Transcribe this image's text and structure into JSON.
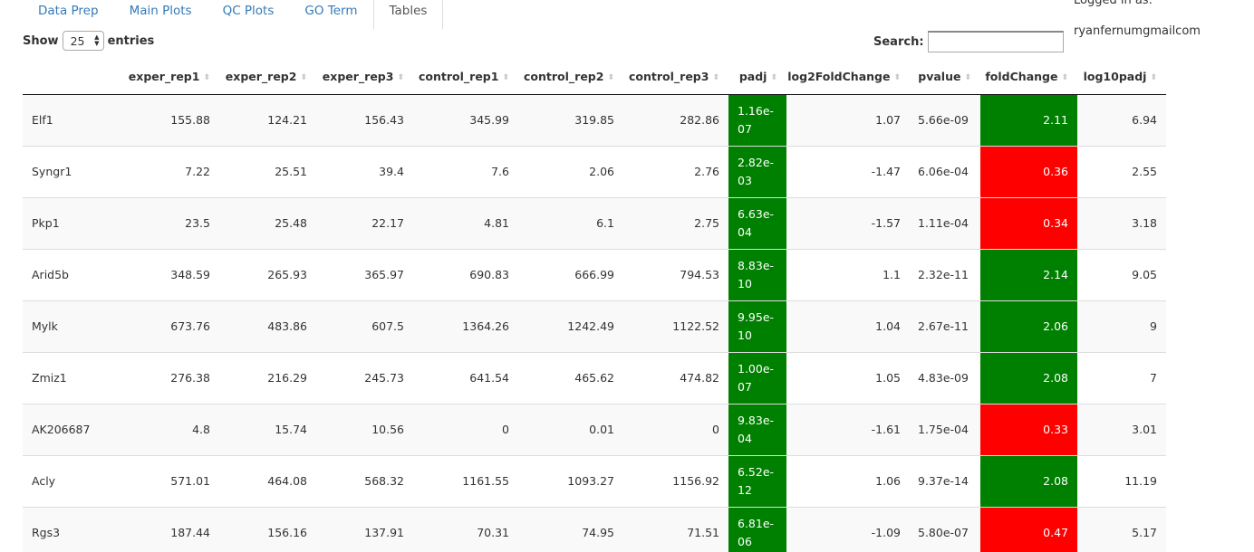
{
  "colors": {
    "green": "#008000",
    "red": "#ff0000",
    "link": "#337ab7"
  },
  "tabs": [
    {
      "label": "Data Prep"
    },
    {
      "label": "Main Plots"
    },
    {
      "label": "QC Plots"
    },
    {
      "label": "GO Term"
    },
    {
      "label": "Tables"
    }
  ],
  "active_tab": "Tables",
  "login": {
    "label": "Logged in as:",
    "user": "ryanfernumgmailcom"
  },
  "length": {
    "show_label": "Show",
    "value": "25",
    "entries_label": "entries"
  },
  "search": {
    "label": "Search:",
    "value": ""
  },
  "table": {
    "columns": [
      "",
      "exper_rep1",
      "exper_rep2",
      "exper_rep3",
      "control_rep1",
      "control_rep2",
      "control_rep3",
      "padj",
      "log2FoldChange",
      "pvalue",
      "foldChange",
      "log10padj"
    ],
    "rows": [
      [
        "Elf1",
        "155.88",
        "124.21",
        "156.43",
        "345.99",
        "319.85",
        "282.86",
        "1.16e-07",
        "1.07",
        "5.66e-09",
        "2.11",
        "6.94"
      ],
      [
        "Syngr1",
        "7.22",
        "25.51",
        "39.4",
        "7.6",
        "2.06",
        "2.76",
        "2.82e-03",
        "-1.47",
        "6.06e-04",
        "0.36",
        "2.55"
      ],
      [
        "Pkp1",
        "23.5",
        "25.48",
        "22.17",
        "4.81",
        "6.1",
        "2.75",
        "6.63e-04",
        "-1.57",
        "1.11e-04",
        "0.34",
        "3.18"
      ],
      [
        "Arid5b",
        "348.59",
        "265.93",
        "365.97",
        "690.83",
        "666.99",
        "794.53",
        "8.83e-10",
        "1.1",
        "2.32e-11",
        "2.14",
        "9.05"
      ],
      [
        "Mylk",
        "673.76",
        "483.86",
        "607.5",
        "1364.26",
        "1242.49",
        "1122.52",
        "9.95e-10",
        "1.04",
        "2.67e-11",
        "2.06",
        "9"
      ],
      [
        "Zmiz1",
        "276.38",
        "216.29",
        "245.73",
        "641.54",
        "465.62",
        "474.82",
        "1.00e-07",
        "1.05",
        "4.83e-09",
        "2.08",
        "7"
      ],
      [
        "AK206687",
        "4.8",
        "15.74",
        "10.56",
        "0",
        "0.01",
        "0",
        "9.83e-04",
        "-1.61",
        "1.75e-04",
        "0.33",
        "3.01"
      ],
      [
        "Acly",
        "571.01",
        "464.08",
        "568.32",
        "1161.55",
        "1093.27",
        "1156.92",
        "6.52e-12",
        "1.06",
        "9.37e-14",
        "2.08",
        "11.19"
      ],
      [
        "Rgs3",
        "187.44",
        "156.16",
        "137.91",
        "70.31",
        "74.95",
        "71.51",
        "6.81e-06",
        "-1.09",
        "5.80e-07",
        "0.47",
        "5.17"
      ]
    ],
    "padj_colors": [
      "green",
      "green",
      "green",
      "green",
      "green",
      "green",
      "green",
      "green",
      "green"
    ],
    "foldchange_colors": [
      "green",
      "red",
      "red",
      "green",
      "green",
      "green",
      "red",
      "green",
      "red"
    ]
  }
}
